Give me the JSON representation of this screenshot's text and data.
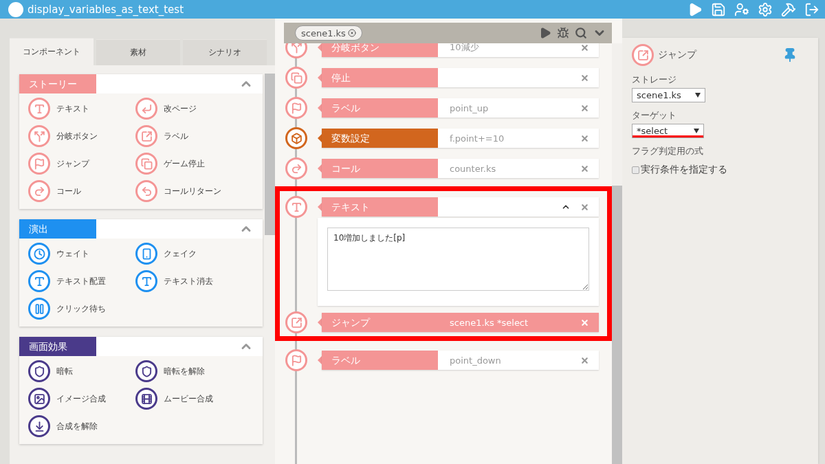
{
  "window": {
    "title": "display_variables_as_text_test"
  },
  "left_tabs": [
    {
      "label": "コンポーネント",
      "selected": true
    },
    {
      "label": "素材",
      "selected": false
    },
    {
      "label": "シナリオ",
      "selected": false
    }
  ],
  "sections": [
    {
      "title": "ストーリー",
      "color": "#f49595",
      "expanded": true,
      "items": [
        "テキスト",
        "改ページ",
        "分岐ボタン",
        "ラベル",
        "ジャンプ",
        "ゲーム停止",
        "コール",
        "コールリターン"
      ]
    },
    {
      "title": "演出",
      "color": "#1e90f0",
      "expanded": true,
      "items": [
        "ウェイト",
        "クェイク",
        "テキスト配置",
        "テキスト消去",
        "クリック待ち"
      ]
    },
    {
      "title": "画面効果",
      "color": "#4a3a8a",
      "expanded": true,
      "items": [
        "暗転",
        "暗転を解除",
        "イメージ合成",
        "ムービー合成",
        "合成を解除"
      ]
    }
  ],
  "editor": {
    "file_tab": "scene1.ks",
    "rows": [
      {
        "label": "分岐ボタン",
        "value": "10減少",
        "color": "#f49595",
        "selected": false,
        "expanded": false
      },
      {
        "label": "停止",
        "value": "",
        "color": "#f49595",
        "selected": false,
        "expanded": false
      },
      {
        "label": "ラベル",
        "value": "point_up",
        "color": "#f49595",
        "selected": false,
        "expanded": false
      },
      {
        "label": "変数設定",
        "value": "f.point+=10",
        "color": "#d2661e",
        "selected": false,
        "expanded": false
      },
      {
        "label": "コール",
        "value": "counter.ks",
        "color": "#f49595",
        "selected": false,
        "expanded": false
      }
    ],
    "highlight_frame": {
      "rows": [
        {
          "label": "テキスト",
          "value": "",
          "color": "#f49595",
          "selected": false,
          "expanded": true,
          "text": "10増加しました[p]"
        },
        {
          "label": "ジャンプ",
          "value": "scene1.ks *select",
          "color": "#f49595",
          "selected": true,
          "expanded": false
        }
      ]
    },
    "rows_below": [
      {
        "label": "ラベル",
        "value": "point_down",
        "color": "#f49595",
        "selected": false,
        "expanded": false
      }
    ]
  },
  "properties": {
    "title": "ジャンプ",
    "fields": [
      {
        "label": "ストレージ",
        "value": "scene1.ks",
        "highlighted": false
      },
      {
        "label": "ターゲット",
        "value": "*select",
        "highlighted": true
      }
    ],
    "expression_label": "フラグ判定用の式",
    "condition": {
      "label": "実行条件を指定する",
      "checked": false
    }
  }
}
